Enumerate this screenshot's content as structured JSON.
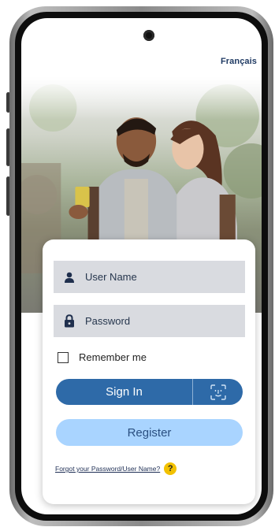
{
  "header": {
    "language_link": "Français"
  },
  "hero": {
    "image_icon": "couple-looking-at-phone-photo"
  },
  "login_form": {
    "username_placeholder": "User Name",
    "username_icon": "person-icon",
    "password_placeholder": "Password",
    "password_icon": "lock-icon",
    "remember_me_label": "Remember me",
    "remember_me_checked": false,
    "sign_in_label": "Sign In",
    "face_id_icon": "face-id-icon",
    "register_label": "Register",
    "forgot_link": "Forgot your Password/User Name?",
    "help_icon_text": "?"
  },
  "colors": {
    "primary": "#2e6aa8",
    "secondary": "#a9d4ff",
    "field_bg": "#d9dbe0",
    "link": "#1f3a63",
    "help": "#f2c100"
  }
}
